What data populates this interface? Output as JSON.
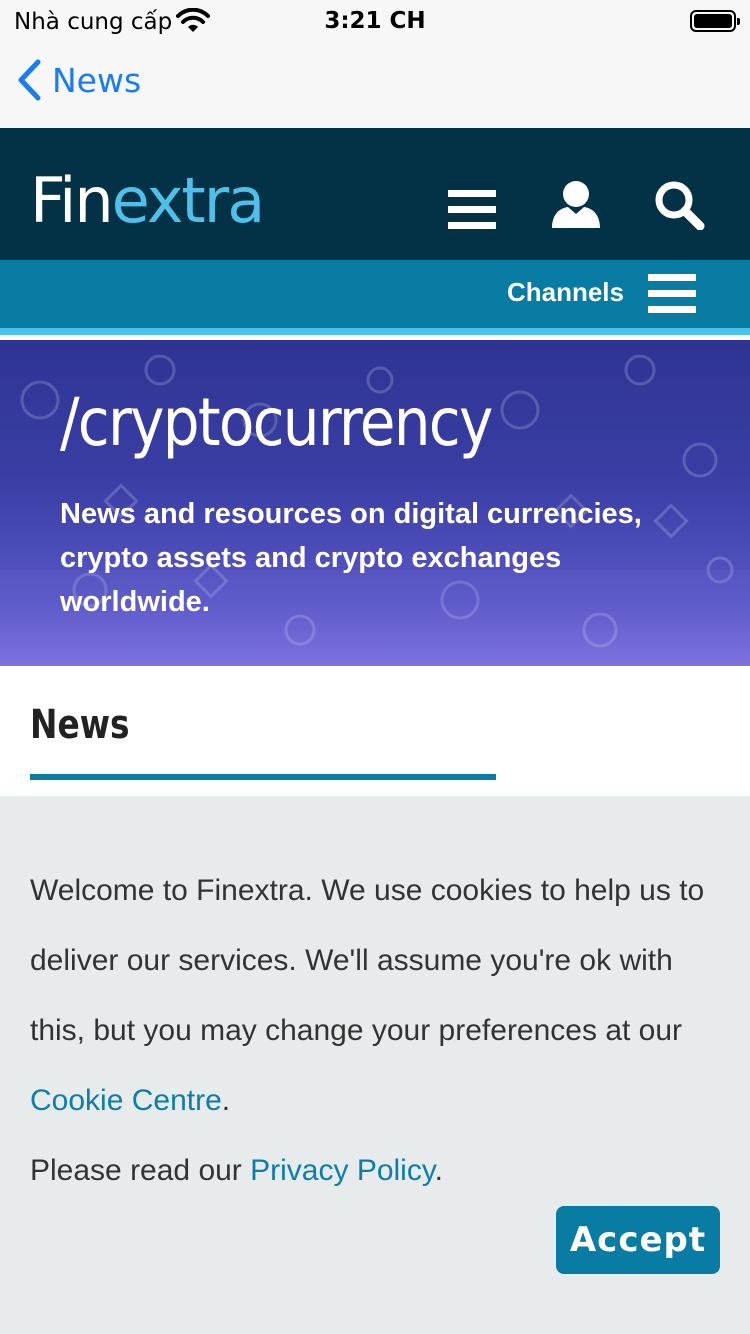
{
  "status_bar": {
    "carrier": "Nhà cung cấp",
    "time": "3:21 CH"
  },
  "nav": {
    "back_label": "News"
  },
  "header": {
    "logo_part1": "Fin",
    "logo_part2": "extra",
    "icons": [
      "menu-icon",
      "user-icon",
      "search-icon"
    ]
  },
  "channels": {
    "label": "Channels"
  },
  "hero": {
    "title": "/cryptocurrency",
    "description": "News and resources on digital currencies, crypto assets and crypto exchanges worldwide."
  },
  "section": {
    "heading": "News"
  },
  "cookie_banner": {
    "text_before_link": "Welcome to Finextra. We use cookies to help us to deliver our services. We'll assume you're ok with this, but you may change your preferences at our ",
    "cookie_link": "Cookie Centre",
    "text_after_link": ".",
    "privacy_prefix": "Please read our ",
    "privacy_link": "Privacy Policy",
    "privacy_suffix": ".",
    "accept_label": "Accept"
  },
  "colors": {
    "header_bg": "#033246",
    "channels_bg": "#087ca3",
    "logo_accent": "#4fc0ea",
    "link": "#0c7ea8",
    "ios_blue": "#1a7cf5"
  }
}
